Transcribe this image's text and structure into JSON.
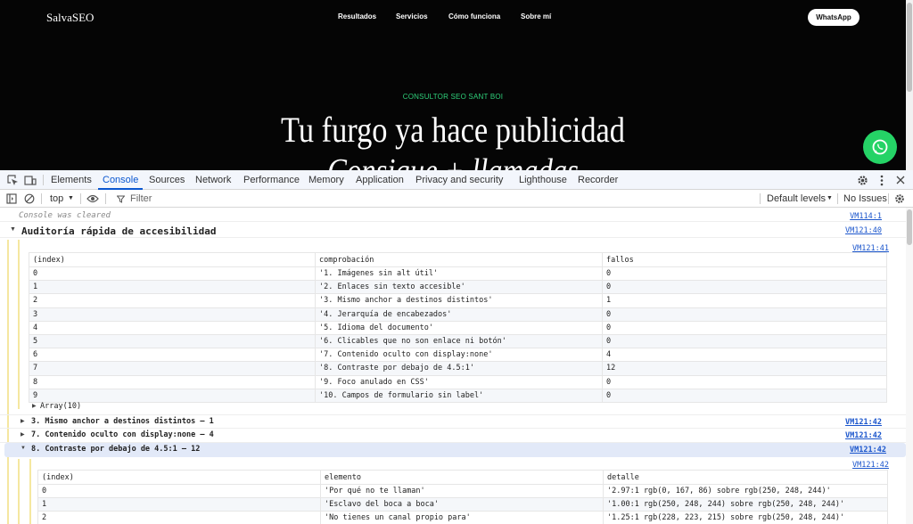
{
  "site": {
    "logo": "SalvaSEO",
    "nav": [
      "Resultados",
      "Servicios",
      "Cómo funciona",
      "Sobre mí"
    ],
    "cta": "WhatsApp",
    "eyebrow": "CONSULTOR SEO SANT BOI",
    "headline": "Tu furgo ya hace publicidad",
    "headline2": "Consigue + llamadas",
    "accent": "#25d366"
  },
  "devtools": {
    "tabs": [
      "Elements",
      "Console",
      "Sources",
      "Network",
      "Performance",
      "Memory",
      "Application",
      "Privacy and security",
      "Lighthouse",
      "Recorder"
    ],
    "active_tab": "Console",
    "context": "top",
    "filter_placeholder": "Filter",
    "levels": "Default levels",
    "issues": "No Issues"
  },
  "console": {
    "cleared": "Console was cleared",
    "cleared_src": "VM114:1",
    "group_title": "Auditoría rápida de accesibilidad",
    "group_src": "VM121:40",
    "table1_src": "VM121:41",
    "table1": {
      "headers": [
        "(index)",
        "comprobación",
        "fallos"
      ],
      "rows": [
        [
          "0",
          "'1. Imágenes sin alt útil'",
          "0"
        ],
        [
          "1",
          "'2. Enlaces sin texto accesible'",
          "0"
        ],
        [
          "2",
          "'3. Mismo anchor a destinos distintos'",
          "1"
        ],
        [
          "3",
          "'4. Jerarquía de encabezados'",
          "0"
        ],
        [
          "4",
          "'5. Idioma del documento'",
          "0"
        ],
        [
          "5",
          "'6. Clicables que no son enlace ni botón'",
          "0"
        ],
        [
          "6",
          "'7. Contenido oculto con display:none'",
          "4"
        ],
        [
          "7",
          "'8. Contraste por debajo de 4.5:1'",
          "12"
        ],
        [
          "8",
          "'9. Foco anulado en CSS'",
          "0"
        ],
        [
          "9",
          "'10. Campos de formulario sin label'",
          "0"
        ]
      ],
      "footer": "Array(10)"
    },
    "groups": [
      {
        "title": "3. Mismo anchor a destinos distintos — 1",
        "src": "VM121:42"
      },
      {
        "title": "7. Contenido oculto con display:none — 4",
        "src": "VM121:42"
      },
      {
        "title": "8. Contraste por debajo de 4.5:1 — 12",
        "src": "VM121:42"
      }
    ],
    "table2_src": "VM121:42",
    "table2": {
      "headers": [
        "(index)",
        "elemento",
        "detalle"
      ],
      "rows": [
        [
          "0",
          "'Por qué no te llaman'",
          "'2.97:1 rgb(0, 167, 86) sobre rgb(250, 248, 244)'"
        ],
        [
          "1",
          "'Esclavo del boca a boca'",
          "'1.00:1 rgb(250, 248, 244) sobre rgb(250, 248, 244)'"
        ],
        [
          "2",
          "'No tienes un canal propio para'",
          "'1.25:1 rgb(228, 223, 215) sobre rgb(250, 248, 244)'"
        ]
      ]
    }
  }
}
